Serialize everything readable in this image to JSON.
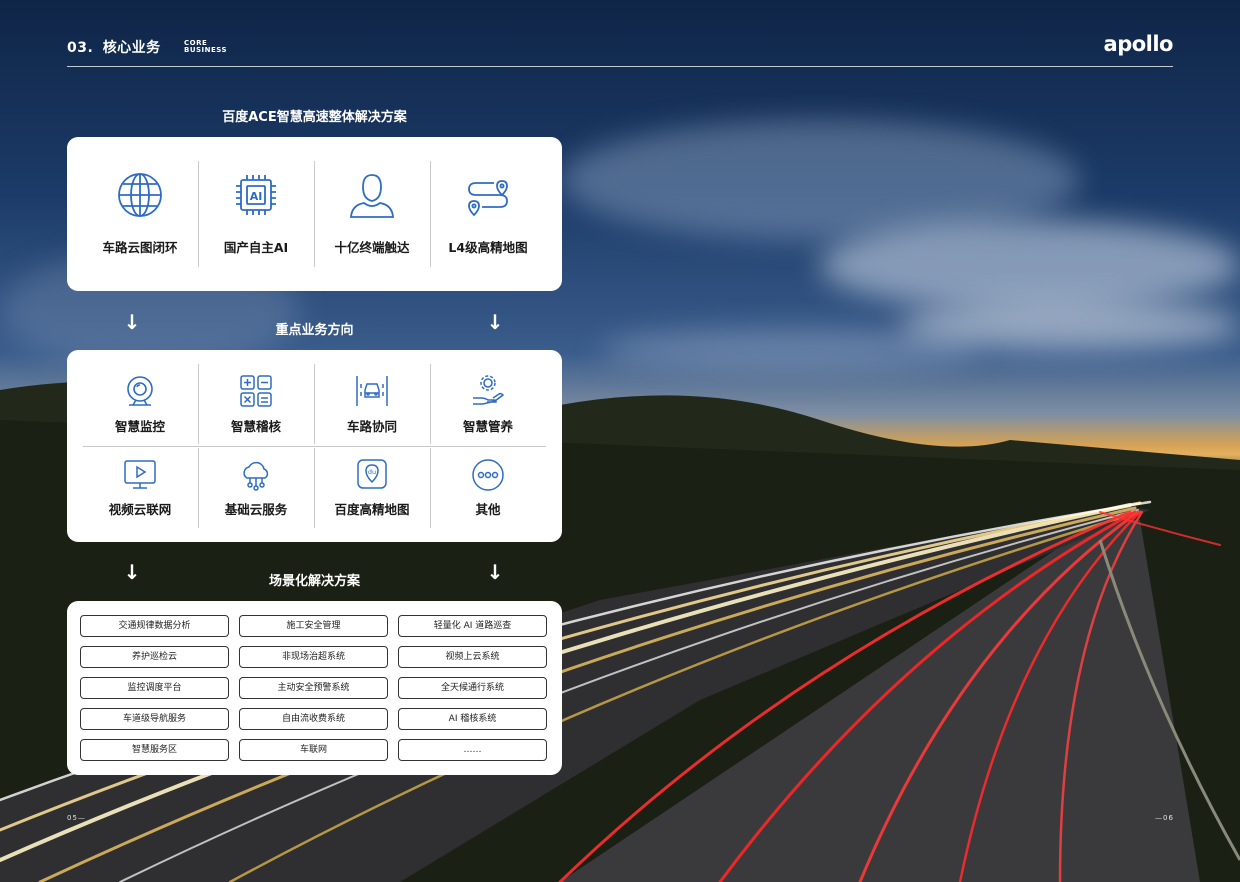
{
  "header": {
    "section_number": "03.",
    "section_title": "核心业务",
    "section_sub_line1": "CORE",
    "section_sub_line2": "BUSINESS",
    "brand": "apollo"
  },
  "solution": {
    "title": "百度ACE智慧高速整体解决方案",
    "pillars": [
      {
        "label": "车路云图闭环",
        "icon": "globe-icon"
      },
      {
        "label": "国产自主AI",
        "icon": "ai-chip-icon"
      },
      {
        "label": "十亿终端触达",
        "icon": "person-icon"
      },
      {
        "label": "L4级高精地图",
        "icon": "route-map-icon"
      }
    ]
  },
  "business": {
    "title": "重点业务方向",
    "items": [
      {
        "label": "智慧监控",
        "icon": "camera-icon"
      },
      {
        "label": "智慧稽核",
        "icon": "calculator-icon"
      },
      {
        "label": "车路协同",
        "icon": "car-road-icon"
      },
      {
        "label": "智慧管养",
        "icon": "gear-hand-icon"
      },
      {
        "label": "视频云联网",
        "icon": "video-icon"
      },
      {
        "label": "基础云服务",
        "icon": "cloud-icon"
      },
      {
        "label": "百度高精地图",
        "icon": "du-map-icon"
      },
      {
        "label": "其他",
        "icon": "more-icon"
      }
    ]
  },
  "scenarios": {
    "title": "场景化解决方案",
    "items": [
      "交通规律数据分析",
      "施工安全管理",
      "轻量化 AI 道路巡查",
      "养护巡检云",
      "非现场治超系统",
      "视频上云系统",
      "监控调度平台",
      "主动安全预警系统",
      "全天候通行系统",
      "车道级导航服务",
      "自由流收费系统",
      "AI 稽核系统",
      "智慧服务区",
      "车联网",
      "……"
    ]
  },
  "arrow_glyph": "↓",
  "page_numbers": {
    "left": "05",
    "right": "06"
  },
  "colors": {
    "icon_blue": "#2e6cc4",
    "panel_bg": "#ffffff"
  }
}
